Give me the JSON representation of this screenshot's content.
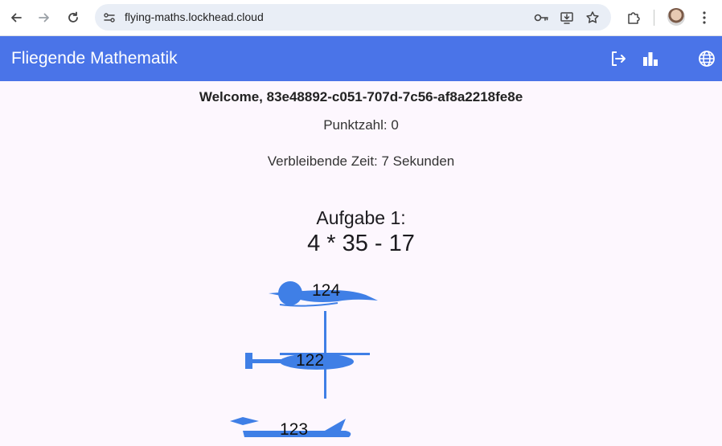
{
  "browser": {
    "url": "flying-maths.lockhead.cloud"
  },
  "app": {
    "title": "Fliegende Mathematik"
  },
  "main": {
    "welcome": "Welcome, 83e48892-c051-707d-7c56-af8a2218fe8e",
    "score": "Punktzahl: 0",
    "timer": "Verbleibende Zeit: 7 Sekunden",
    "task_label": "Aufgabe 1:",
    "equation": "4 * 35 - 17",
    "answers": [
      "124",
      "122",
      "123"
    ]
  },
  "colors": {
    "appbar": "#4a74e8",
    "plane": "#3f7fe6",
    "background": "#fdf7fe"
  }
}
